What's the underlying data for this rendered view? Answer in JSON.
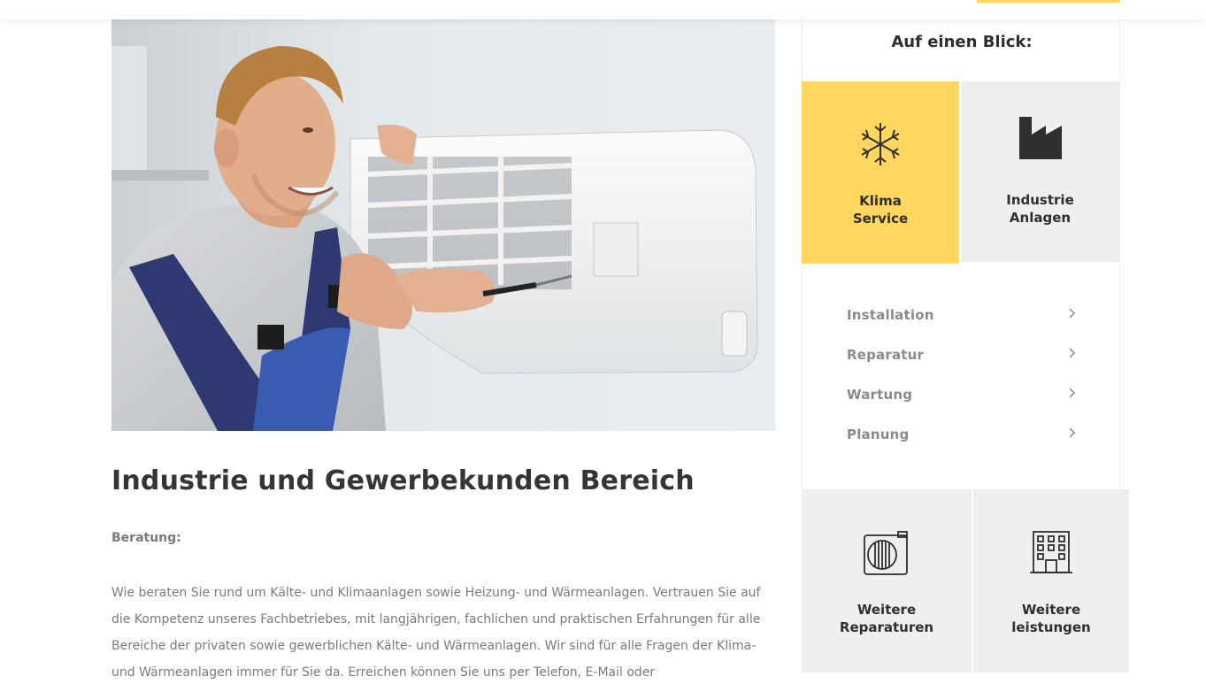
{
  "header": {
    "accent_color": "#ffd75e"
  },
  "hero": {
    "image": "technician-servicing-wall-air-conditioner"
  },
  "content": {
    "headline": "Industrie und Gewerbekunden Bereich",
    "section_label": "Beratung:",
    "body": "Wie beraten Sie rund um Kälte- und Klimaanlagen sowie Heizung- und Wärmeanlagen. Vertrauen Sie auf die Kompetenz unseres Fachbetriebes, mit langjährigen, fachlichen und praktischen Erfahrungen für alle Bereiche der privaten sowie gewerblichen Kälte- und Wärmeanlagen. Wir sind für alle Fragen der Klima- und Wärmeanlagen immer für Sie da. Erreichen können Sie uns per Telefon, E-Mail oder"
  },
  "sidebar": {
    "title": "Auf einen Blick:",
    "tiles": [
      {
        "line1": "Klima",
        "line2": "Service",
        "icon": "snowflake-icon",
        "active": true
      },
      {
        "line1": "Industrie",
        "line2": "Anlagen",
        "icon": "factory-icon",
        "active": false
      }
    ],
    "menu": [
      {
        "label": "Installation"
      },
      {
        "label": "Reparatur"
      },
      {
        "label": "Wartung"
      },
      {
        "label": "Planung"
      }
    ],
    "bottom_tiles": [
      {
        "line1": "Weitere",
        "line2": "Reparaturen",
        "icon": "ac-unit-icon"
      },
      {
        "line1": "Weitere",
        "line2": "leistungen",
        "icon": "building-icon"
      }
    ]
  },
  "colors": {
    "accent": "#ffd75e",
    "tile_bg": "#efefef",
    "text_dark": "#2f2f2f",
    "text_muted": "#7b7b7b"
  }
}
